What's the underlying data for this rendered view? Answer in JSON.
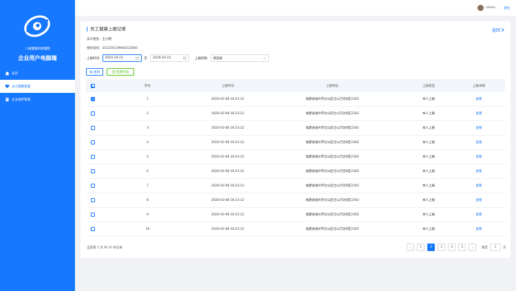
{
  "sidebar": {
    "logo": "swirl-logo-icon",
    "subtitle": "八闽健康码管理网",
    "title": "企业用户电脑端",
    "items": [
      {
        "label": "首页",
        "icon": "home-icon",
        "active": false
      },
      {
        "label": "员工健康管理",
        "icon": "heart-icon",
        "active": true
      },
      {
        "label": "企业组织管理",
        "icon": "building-icon",
        "active": false
      }
    ]
  },
  "header": {
    "user": "admin",
    "logout": "退出"
  },
  "page": {
    "title": "员工健康上报记录",
    "back": "返回",
    "name_label": "员工姓名：",
    "name": "王小明",
    "id_label": "身份证号：",
    "id_number": "352220119940312005",
    "filters": {
      "time_label": "上报时间:",
      "start_date": "2019-10-23",
      "to": "至",
      "end_date": "2019-10-23",
      "result_label": "上报结果:",
      "result_value": "请选择"
    },
    "search_button": "查询",
    "export_button": "批量导出"
  },
  "table": {
    "headers": [
      "序号",
      "上报时间",
      "上报地址",
      "上报类型",
      "上报详情"
    ],
    "rows": [
      {
        "no": "1",
        "time": "2020-02-08 18:23:12",
        "address": "福建省福州市仓山区仓山万达B区2302",
        "type": "本人上报",
        "action": "查看",
        "checked": true
      },
      {
        "no": "2",
        "time": "2020-02-08 18:23:12",
        "address": "福建省福州市仓山区仓山万达B区2302",
        "type": "本人上报",
        "action": "查看",
        "checked": false
      },
      {
        "no": "3",
        "time": "2020-02-08 18:23:12",
        "address": "福建省福州市仓山区仓山万达B区2302",
        "type": "本人上报",
        "action": "查看",
        "checked": false
      },
      {
        "no": "4",
        "time": "2020-02-08 18:23:12",
        "address": "福建省福州市仓山区仓山万达B区2302",
        "type": "本人上报",
        "action": "查看",
        "checked": false
      },
      {
        "no": "5",
        "time": "2020-02-08 18:23:12",
        "address": "福建省福州市仓山区仓山万达B区2302",
        "type": "本人上报",
        "action": "查看",
        "checked": false
      },
      {
        "no": "6",
        "time": "2020-02-08 18:23:12",
        "address": "福建省福州市仓山区仓山万达B区2302",
        "type": "本人上报",
        "action": "查看",
        "checked": false
      },
      {
        "no": "7",
        "time": "2020-02-08 18:23:12",
        "address": "福建省福州市仓山区仓山万达B区2302",
        "type": "本人上报",
        "action": "查看",
        "checked": false
      },
      {
        "no": "8",
        "time": "2020-02-08 18:23:12",
        "address": "福建省福州市仓山区仓山万达B区2302",
        "type": "本人上报",
        "action": "查看",
        "checked": false
      },
      {
        "no": "9",
        "time": "2020-02-08 18:23:12",
        "address": "福建省福州市仓山区仓山万达B区2302",
        "type": "本人上报",
        "action": "查看",
        "checked": false
      },
      {
        "no": "10",
        "time": "2020-02-08 18:23:12",
        "address": "福建省福州市仓山区仓山万达B区2302",
        "type": "本人上报",
        "action": "查看",
        "checked": false
      }
    ]
  },
  "footer": {
    "summary": "当前第 1 页  共 10 条记录"
  },
  "pagination": {
    "pages": [
      "1",
      "2",
      "3",
      "4",
      "5"
    ],
    "current": "2",
    "goto_label": "跳至",
    "goto_value": "1",
    "goto_suffix": "页"
  },
  "colors": {
    "primary": "#1677ff",
    "export_green": "#52c41a"
  }
}
